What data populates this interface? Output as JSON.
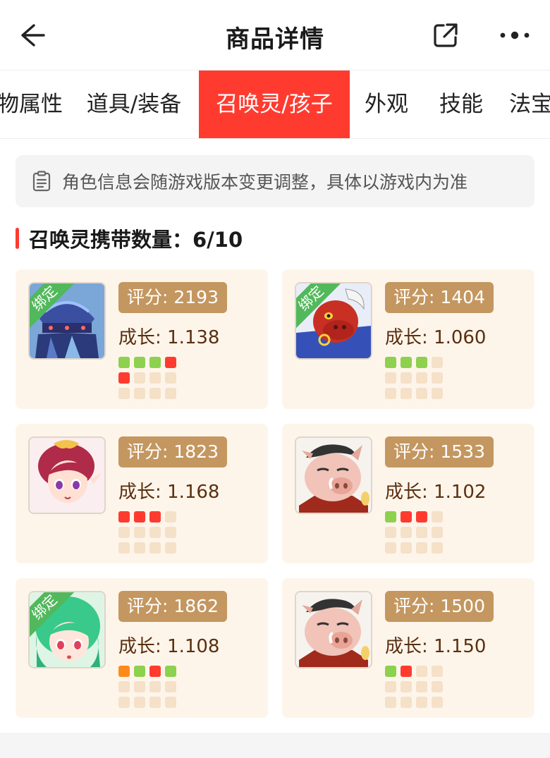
{
  "header": {
    "title": "商品详情",
    "back_icon": "arrow-left-icon",
    "share_icon": "share-icon",
    "more_icon": "more-dots-icon"
  },
  "tabs": [
    {
      "label": "物属性",
      "active": false
    },
    {
      "label": "道具/装备",
      "active": false
    },
    {
      "label": "召唤灵/孩子",
      "active": true
    },
    {
      "label": "外观",
      "active": false
    },
    {
      "label": "技能",
      "active": false
    },
    {
      "label": "法宝",
      "active": false
    }
  ],
  "notice": {
    "icon": "clipboard-icon",
    "text": "角色信息会随游戏版本变更调整，具体以游戏内为准"
  },
  "section": {
    "title": "召唤灵携带数量：6/10"
  },
  "colors": {
    "accent": "#ff3b30",
    "badge_bg": "#c49760",
    "card_bg": "#fef5ea",
    "dot_green": "#8dd14e",
    "dot_red": "#ff3b30",
    "dot_orange": "#ff8a1c",
    "dot_empty": "#f5e0c8",
    "bind_green": "#52b85c"
  },
  "pets": [
    {
      "score": "评分: 2193",
      "growth": "成长: 1.138",
      "bound": true,
      "bind_label": "绑定",
      "avatar": "blue-armored-beast-avatar",
      "dots": [
        "green",
        "green",
        "green",
        "red",
        "red",
        "empty",
        "empty",
        "empty",
        "empty",
        "empty",
        "empty",
        "empty"
      ]
    },
    {
      "score": "评分: 1404",
      "growth": "成长: 1.060",
      "bound": true,
      "bind_label": "绑定",
      "avatar": "red-bull-demon-avatar",
      "dots": [
        "green",
        "green",
        "green",
        "empty",
        "empty",
        "empty",
        "empty",
        "empty",
        "empty",
        "empty",
        "empty",
        "empty"
      ]
    },
    {
      "score": "评分: 1823",
      "growth": "成长: 1.168",
      "bound": false,
      "bind_label": "",
      "avatar": "red-haired-girl-avatar",
      "dots": [
        "red",
        "red",
        "red",
        "empty",
        "empty",
        "empty",
        "empty",
        "empty",
        "empty",
        "empty",
        "empty",
        "empty"
      ]
    },
    {
      "score": "评分: 1533",
      "growth": "成长: 1.102",
      "bound": false,
      "bind_label": "",
      "avatar": "pig-warrior-avatar",
      "dots": [
        "green",
        "red",
        "red",
        "empty",
        "empty",
        "empty",
        "empty",
        "empty",
        "empty",
        "empty",
        "empty",
        "empty"
      ]
    },
    {
      "score": "评分: 1862",
      "growth": "成长: 1.108",
      "bound": true,
      "bind_label": "绑定",
      "avatar": "green-haired-girl-avatar",
      "dots": [
        "orange",
        "green",
        "red",
        "green",
        "empty",
        "empty",
        "empty",
        "empty",
        "empty",
        "empty",
        "empty",
        "empty"
      ]
    },
    {
      "score": "评分: 1500",
      "growth": "成长: 1.150",
      "bound": false,
      "bind_label": "",
      "avatar": "pig-warrior-avatar",
      "dots": [
        "green",
        "red",
        "empty",
        "empty",
        "empty",
        "empty",
        "empty",
        "empty",
        "empty",
        "empty",
        "empty",
        "empty"
      ]
    }
  ]
}
